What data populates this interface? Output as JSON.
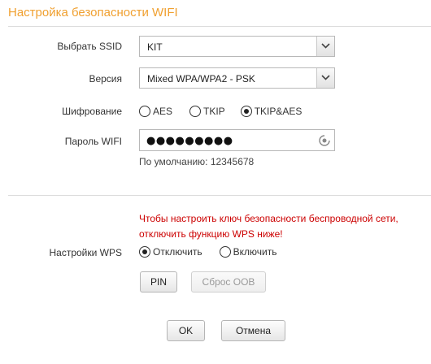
{
  "page": {
    "title": "Настройка безопасности WIFI"
  },
  "ssid": {
    "label": "Выбрать SSID",
    "value": "KIT"
  },
  "version": {
    "label": "Версия",
    "value": "Mixed WPA/WPA2 - PSK"
  },
  "encryption": {
    "label": "Шифрование",
    "options": [
      "AES",
      "TKIP",
      "TKIP&AES"
    ],
    "selected": "TKIP&AES"
  },
  "password": {
    "label": "Пароль WIFI",
    "masked_value": "●●●●●●●●●",
    "hint": "По умолчанию: 12345678"
  },
  "wps": {
    "warning_line1": "Чтобы настроить ключ безопасности беспроводной сети,",
    "warning_line2": "отключить функцию WPS ниже!",
    "label": "Настройки WPS",
    "options": [
      "Отключить",
      "Включить"
    ],
    "selected": "Отключить",
    "pin_button": "PIN",
    "reset_button": "Сброс OOB"
  },
  "actions": {
    "ok": "OK",
    "cancel": "Отмена"
  },
  "colors": {
    "title": "#f0a030",
    "warning": "#cc0000"
  }
}
